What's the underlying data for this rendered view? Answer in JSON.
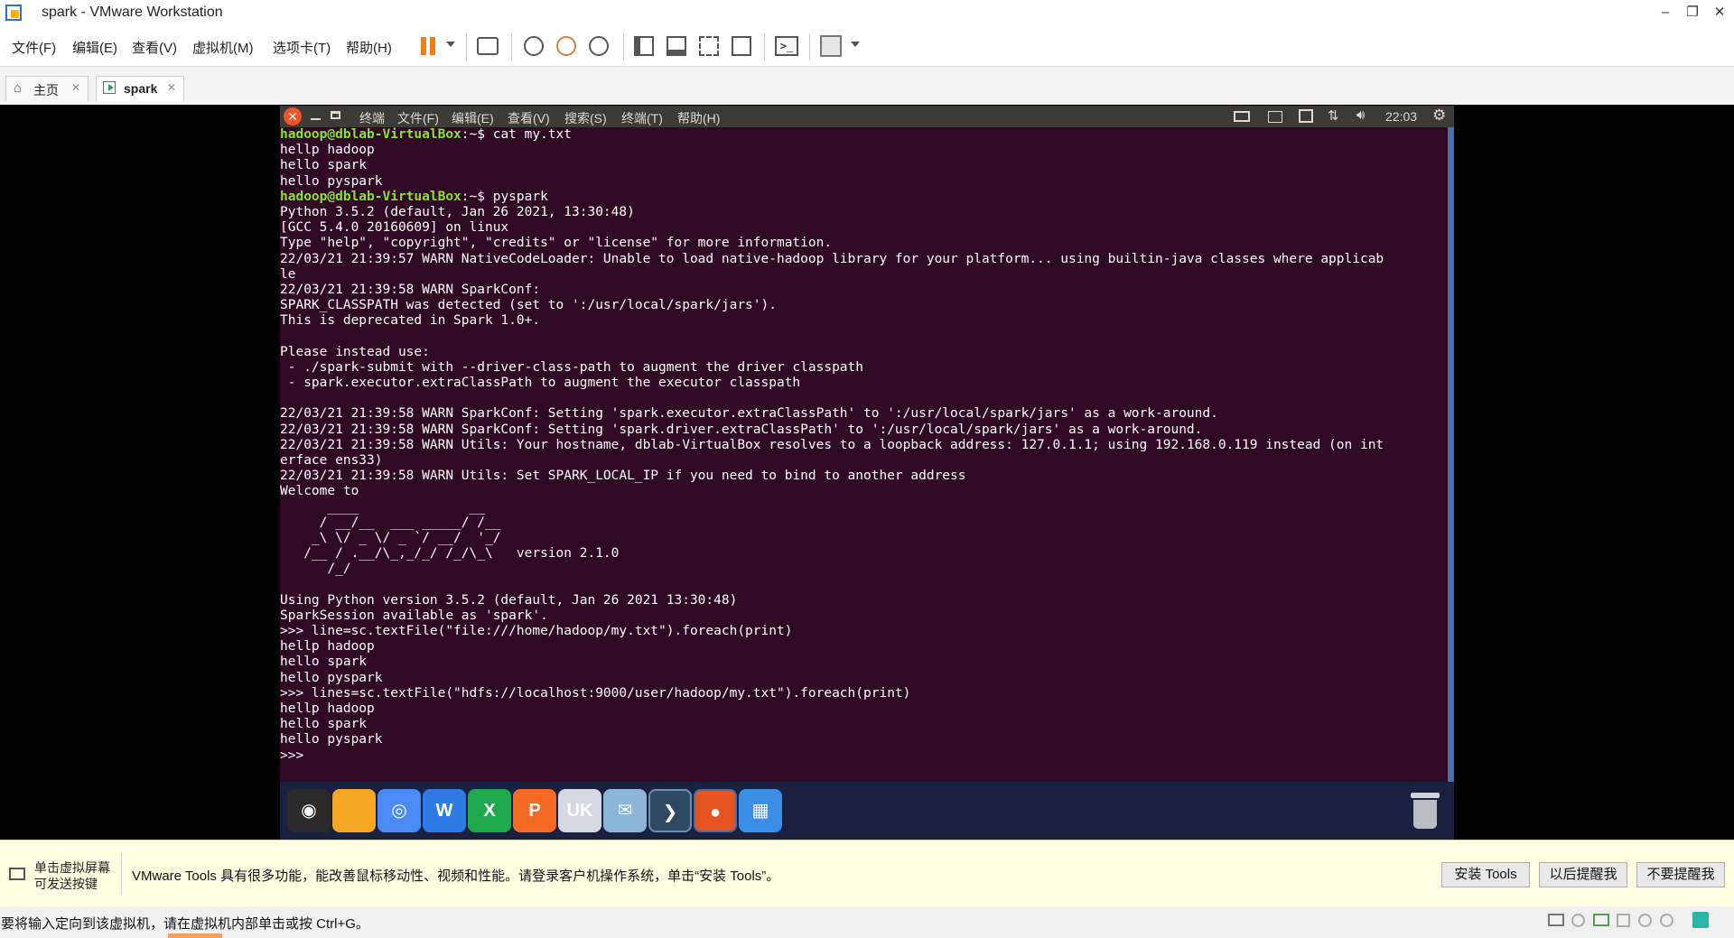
{
  "window": {
    "title": "spark - VMware Workstation",
    "minimize": "–",
    "restore": "❐",
    "close": "✕"
  },
  "menubar": {
    "items": [
      "文件(F)",
      "编辑(E)",
      "查看(V)",
      "虚拟机(M)",
      "选项卡(T)",
      "帮助(H)"
    ]
  },
  "tabs": [
    {
      "label": "主页",
      "close": "✕"
    },
    {
      "label": "spark",
      "close": "✕"
    }
  ],
  "guest_topbar": {
    "menus": [
      "终端",
      "文件(F)",
      "编辑(E)",
      "查看(V)",
      "搜索(S)",
      "终端(T)",
      "帮助(H)"
    ],
    "clock": "22:03",
    "close_glyph": "✕"
  },
  "terminal": {
    "prompt": "hadoop@dblab-VirtualBox",
    "lines": [
      {
        "p": true,
        "cmd": ":~$ cat my.txt"
      },
      {
        "t": "hellp hadoop"
      },
      {
        "t": "hello spark"
      },
      {
        "t": "hello pyspark"
      },
      {
        "p": true,
        "cmd": ":~$ pyspark"
      },
      {
        "t": "Python 3.5.2 (default, Jan 26 2021, 13:30:48)"
      },
      {
        "t": "[GCC 5.4.0 20160609] on linux"
      },
      {
        "t": "Type \"help\", \"copyright\", \"credits\" or \"license\" for more information."
      },
      {
        "t": "22/03/21 21:39:57 WARN NativeCodeLoader: Unable to load native-hadoop library for your platform... using builtin-java classes where applicab"
      },
      {
        "t": "le"
      },
      {
        "t": "22/03/21 21:39:58 WARN SparkConf:"
      },
      {
        "t": "SPARK_CLASSPATH was detected (set to ':/usr/local/spark/jars')."
      },
      {
        "t": "This is deprecated in Spark 1.0+."
      },
      {
        "t": ""
      },
      {
        "t": "Please instead use:"
      },
      {
        "t": " - ./spark-submit with --driver-class-path to augment the driver classpath"
      },
      {
        "t": " - spark.executor.extraClassPath to augment the executor classpath"
      },
      {
        "t": ""
      },
      {
        "t": "22/03/21 21:39:58 WARN SparkConf: Setting 'spark.executor.extraClassPath' to ':/usr/local/spark/jars' as a work-around."
      },
      {
        "t": "22/03/21 21:39:58 WARN SparkConf: Setting 'spark.driver.extraClassPath' to ':/usr/local/spark/jars' as a work-around."
      },
      {
        "t": "22/03/21 21:39:58 WARN Utils: Your hostname, dblab-VirtualBox resolves to a loopback address: 127.0.1.1; using 192.168.0.119 instead (on int"
      },
      {
        "t": "erface ens33)"
      },
      {
        "t": "22/03/21 21:39:58 WARN Utils: Set SPARK_LOCAL_IP if you need to bind to another address"
      },
      {
        "t": "Welcome to"
      },
      {
        "t": "      ____              __"
      },
      {
        "t": "     / __/__  ___ _____/ /__"
      },
      {
        "t": "    _\\ \\/ _ \\/ _ `/ __/  '_/"
      },
      {
        "t": "   /__ / .__/\\_,_/_/ /_/\\_\\   version 2.1.0"
      },
      {
        "t": "      /_/"
      },
      {
        "t": ""
      },
      {
        "t": "Using Python version 3.5.2 (default, Jan 26 2021 13:30:48)"
      },
      {
        "t": "SparkSession available as 'spark'."
      },
      {
        "t": ">>> line=sc.textFile(\"file:///home/hadoop/my.txt\").foreach(print)"
      },
      {
        "t": "hellp hadoop"
      },
      {
        "t": "hello spark"
      },
      {
        "t": "hello pyspark"
      },
      {
        "t": ">>> lines=sc.textFile(\"hdfs://localhost:9000/user/hadoop/my.txt\").foreach(print)"
      },
      {
        "t": "hellp hadoop"
      },
      {
        "t": "hello spark"
      },
      {
        "t": "hello pyspark"
      },
      {
        "t": ">>> "
      }
    ]
  },
  "dock": {
    "items": [
      {
        "name": "ubuntu-home-icon",
        "color": "#2b2b2b",
        "glyph": "◉"
      },
      {
        "name": "files-folder-icon",
        "color": "#f5a623",
        "glyph": ""
      },
      {
        "name": "chromium-icon",
        "color": "#4c8bf5",
        "glyph": "◎"
      },
      {
        "name": "wps-writer-icon",
        "color": "#2f7be5",
        "glyph": "W"
      },
      {
        "name": "wps-sheets-icon",
        "color": "#1ea94e",
        "glyph": "X"
      },
      {
        "name": "wps-presentation-icon",
        "color": "#f46a25",
        "glyph": "P"
      },
      {
        "name": "software-center-icon",
        "color": "#d4d8e0",
        "glyph": "UK"
      },
      {
        "name": "email-client-icon",
        "color": "#8cb6d8",
        "glyph": "✉"
      },
      {
        "name": "terminal-icon",
        "color": "#2e4a63",
        "glyph": "❯"
      },
      {
        "name": "firefox-icon",
        "color": "#e6541f",
        "glyph": "●"
      },
      {
        "name": "workspace-switcher-icon",
        "color": "#3a8ee6",
        "glyph": "▦"
      }
    ]
  },
  "tools_banner": {
    "hint_line1": "单击虚拟屏幕",
    "hint_line2": "可发送按键",
    "message": "VMware Tools 具有很多功能，能改善鼠标移动性、视频和性能。请登录客户机操作系统，单击“安装 Tools”。",
    "install_button": "安装 Tools",
    "remind_later_button": "以后提醒我",
    "never_remind_button": "不要提醒我"
  },
  "statusbar": {
    "text": "要将输入定向到该虚拟机，请在虚拟机内部单击或按 Ctrl+G。"
  },
  "colors": {
    "terminal_bg": "#300a24",
    "prompt_green": "#8ae234",
    "accent_pause": "#f07d1c",
    "close_orange": "#f0542a"
  }
}
